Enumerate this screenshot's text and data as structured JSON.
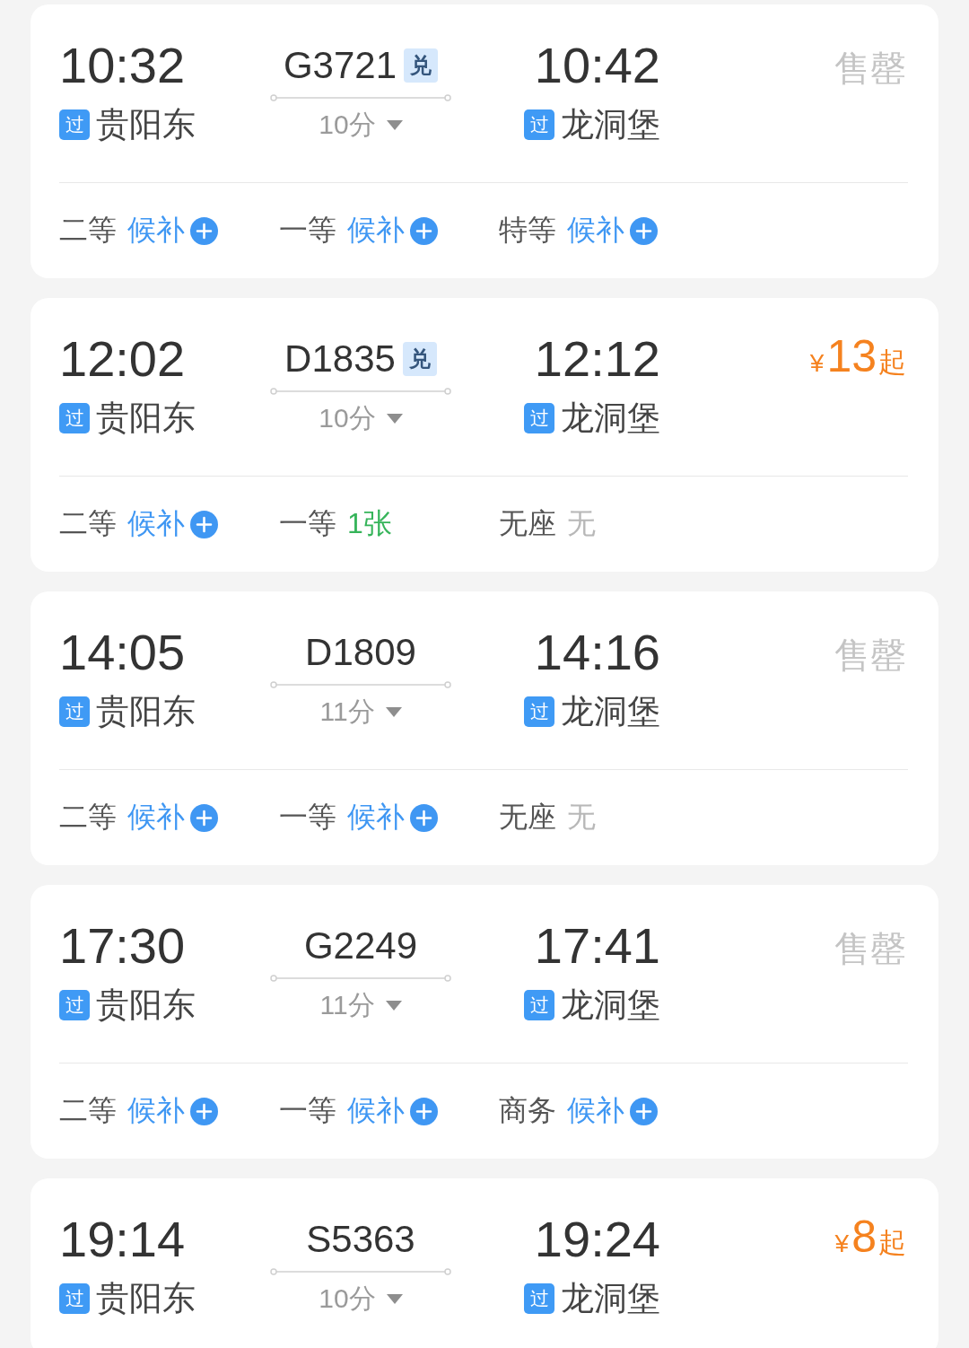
{
  "trains": [
    {
      "depart": {
        "time": "10:32",
        "badge": "过",
        "station": "贵阳东"
      },
      "train_no": "G3721",
      "tag": "兑",
      "duration": "10分",
      "arrive": {
        "time": "10:42",
        "badge": "过",
        "station": "龙洞堡"
      },
      "fare": {
        "kind": "sold_out",
        "text": "售罄"
      },
      "seats": [
        {
          "class": "二等",
          "kind": "waitlist",
          "status": "候补"
        },
        {
          "class": "一等",
          "kind": "waitlist",
          "status": "候补"
        },
        {
          "class": "特等",
          "kind": "waitlist",
          "status": "候补"
        }
      ]
    },
    {
      "depart": {
        "time": "12:02",
        "badge": "过",
        "station": "贵阳东"
      },
      "train_no": "D1835",
      "tag": "兑",
      "duration": "10分",
      "arrive": {
        "time": "12:12",
        "badge": "过",
        "station": "龙洞堡"
      },
      "fare": {
        "kind": "price",
        "currency": "¥",
        "amount": "13",
        "suffix": "起"
      },
      "seats": [
        {
          "class": "二等",
          "kind": "waitlist",
          "status": "候补"
        },
        {
          "class": "一等",
          "kind": "available",
          "status": "1张"
        },
        {
          "class": "无座",
          "kind": "none",
          "status": "无"
        }
      ]
    },
    {
      "depart": {
        "time": "14:05",
        "badge": "过",
        "station": "贵阳东"
      },
      "train_no": "D1809",
      "duration": "11分",
      "arrive": {
        "time": "14:16",
        "badge": "过",
        "station": "龙洞堡"
      },
      "fare": {
        "kind": "sold_out",
        "text": "售罄"
      },
      "seats": [
        {
          "class": "二等",
          "kind": "waitlist",
          "status": "候补"
        },
        {
          "class": "一等",
          "kind": "waitlist",
          "status": "候补"
        },
        {
          "class": "无座",
          "kind": "none",
          "status": "无"
        }
      ]
    },
    {
      "depart": {
        "time": "17:30",
        "badge": "过",
        "station": "贵阳东"
      },
      "train_no": "G2249",
      "duration": "11分",
      "arrive": {
        "time": "17:41",
        "badge": "过",
        "station": "龙洞堡"
      },
      "fare": {
        "kind": "sold_out",
        "text": "售罄"
      },
      "seats": [
        {
          "class": "二等",
          "kind": "waitlist",
          "status": "候补"
        },
        {
          "class": "一等",
          "kind": "waitlist",
          "status": "候补"
        },
        {
          "class": "商务",
          "kind": "waitlist",
          "status": "候补"
        }
      ]
    },
    {
      "depart": {
        "time": "19:14",
        "badge": "过",
        "station": "贵阳东"
      },
      "train_no": "S5363",
      "duration": "10分",
      "arrive": {
        "time": "19:24",
        "badge": "过",
        "station": "龙洞堡"
      },
      "fare": {
        "kind": "price",
        "currency": "¥",
        "amount": "8",
        "suffix": "起"
      }
    }
  ]
}
